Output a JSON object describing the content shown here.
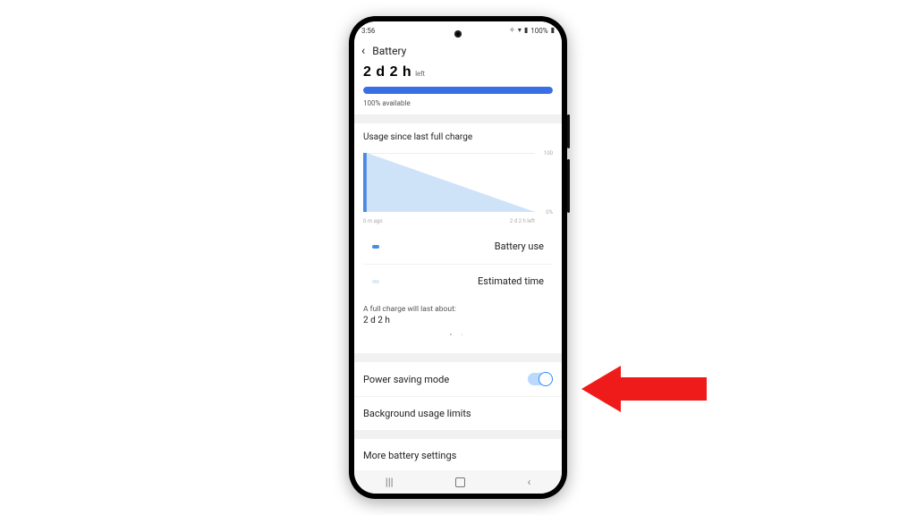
{
  "status_bar": {
    "time": "3:56",
    "battery_pct": "100%"
  },
  "header": {
    "title": "Battery"
  },
  "summary": {
    "estimate": "2 d 2 h",
    "estimate_suffix": "left",
    "available": "100% available",
    "bar_fill_pct": 100
  },
  "usage": {
    "title": "Usage since last full charge",
    "x_left": "0 m ago",
    "x_right": "2 d 2 h left",
    "y_top": "100",
    "y_bot": "0%",
    "legend": {
      "use": "Battery use",
      "est": "Estimated time"
    },
    "predict_label": "A full charge will last about:",
    "predict_value": "2 d 2 h"
  },
  "settings": {
    "power_saving": {
      "label": "Power saving mode",
      "on": true
    },
    "bg_limits": {
      "label": "Background usage limits"
    },
    "more": {
      "label": "More battery settings"
    }
  },
  "nav": {
    "recents": "|||",
    "home": "□",
    "back": "‹"
  },
  "chart_data": {
    "type": "area",
    "title": "Usage since last full charge",
    "xlabel": "",
    "ylabel": "%",
    "ylim": [
      0,
      100
    ],
    "x": [
      "0 m ago",
      "2 d 2 h left"
    ],
    "series": [
      {
        "name": "Battery use",
        "values": [
          100,
          100
        ],
        "color": "#4a8ae3",
        "style": "solid-current"
      },
      {
        "name": "Estimated time",
        "values": [
          100,
          0
        ],
        "color": "#cfe3f8",
        "style": "projection"
      }
    ],
    "annotations": [
      "A full charge will last about: 2 d 2 h"
    ]
  },
  "annotation": {
    "type": "arrow",
    "target": "power-saving-toggle",
    "color": "#ef1a1a"
  }
}
